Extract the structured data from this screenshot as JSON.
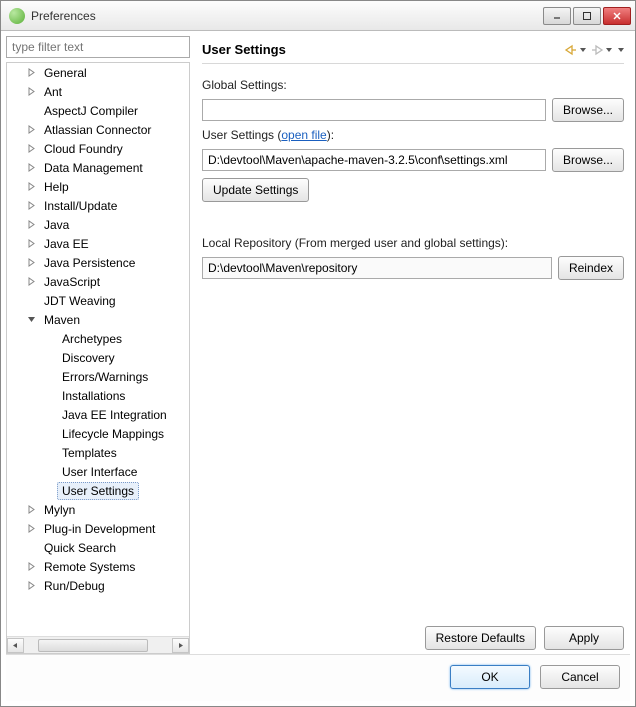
{
  "window": {
    "title": "Preferences"
  },
  "filter": {
    "placeholder": "type filter text"
  },
  "tree": {
    "items": [
      {
        "label": "General",
        "arrow": "right",
        "level": 1
      },
      {
        "label": "Ant",
        "arrow": "right",
        "level": 1
      },
      {
        "label": "AspectJ Compiler",
        "arrow": "none",
        "level": 1
      },
      {
        "label": "Atlassian Connector",
        "arrow": "right",
        "level": 1
      },
      {
        "label": "Cloud Foundry",
        "arrow": "right",
        "level": 1
      },
      {
        "label": "Data Management",
        "arrow": "right",
        "level": 1
      },
      {
        "label": "Help",
        "arrow": "right",
        "level": 1
      },
      {
        "label": "Install/Update",
        "arrow": "right",
        "level": 1
      },
      {
        "label": "Java",
        "arrow": "right",
        "level": 1
      },
      {
        "label": "Java EE",
        "arrow": "right",
        "level": 1
      },
      {
        "label": "Java Persistence",
        "arrow": "right",
        "level": 1
      },
      {
        "label": "JavaScript",
        "arrow": "right",
        "level": 1
      },
      {
        "label": "JDT Weaving",
        "arrow": "none",
        "level": 1
      },
      {
        "label": "Maven",
        "arrow": "down",
        "level": 1
      },
      {
        "label": "Archetypes",
        "arrow": "none",
        "level": 2
      },
      {
        "label": "Discovery",
        "arrow": "none",
        "level": 2
      },
      {
        "label": "Errors/Warnings",
        "arrow": "none",
        "level": 2
      },
      {
        "label": "Installations",
        "arrow": "none",
        "level": 2
      },
      {
        "label": "Java EE Integration",
        "arrow": "none",
        "level": 2
      },
      {
        "label": "Lifecycle Mappings",
        "arrow": "none",
        "level": 2
      },
      {
        "label": "Templates",
        "arrow": "none",
        "level": 2
      },
      {
        "label": "User Interface",
        "arrow": "none",
        "level": 2
      },
      {
        "label": "User Settings",
        "arrow": "none",
        "level": 2,
        "selected": true
      },
      {
        "label": "Mylyn",
        "arrow": "right",
        "level": 1
      },
      {
        "label": "Plug-in Development",
        "arrow": "right",
        "level": 1
      },
      {
        "label": "Quick Search",
        "arrow": "none",
        "level": 1
      },
      {
        "label": "Remote Systems",
        "arrow": "right",
        "level": 1
      },
      {
        "label": "Run/Debug",
        "arrow": "right",
        "level": 1
      }
    ]
  },
  "content": {
    "title": "User Settings",
    "global_label": "Global Settings:",
    "global_value": "",
    "browse1": "Browse...",
    "user_label_pre": "User Settings (",
    "user_link": "open file",
    "user_label_post": "):",
    "user_value": "D:\\devtool\\Maven\\apache-maven-3.2.5\\conf\\settings.xml",
    "browse2": "Browse...",
    "update_btn": "Update Settings",
    "repo_label": "Local Repository (From merged user and global settings):",
    "repo_value": "D:\\devtool\\Maven\\repository",
    "reindex_btn": "Reindex",
    "restore_btn": "Restore Defaults",
    "apply_btn": "Apply"
  },
  "footer": {
    "ok": "OK",
    "cancel": "Cancel"
  }
}
